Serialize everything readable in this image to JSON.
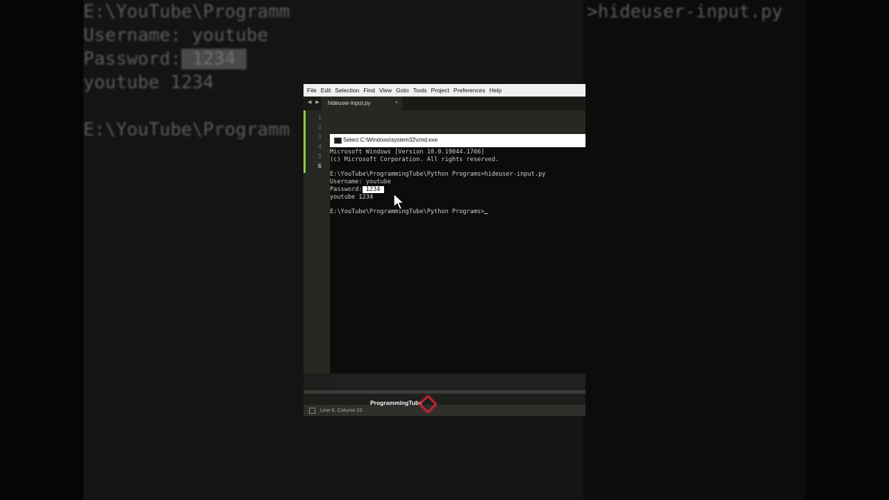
{
  "background": {
    "line1": "E:\\YouTube\\Programm",
    "line1_right": ">hideuser-input.py",
    "username_line": "Username: youtube",
    "password_label": "Password:",
    "password_value": " 1234 ",
    "output_line": "youtube 1234",
    "prompt_line": "E:\\YouTube\\Programm"
  },
  "editor": {
    "menu": [
      "File",
      "Edit",
      "Selection",
      "Find",
      "View",
      "Goto",
      "Tools",
      "Project",
      "Preferences",
      "Help"
    ],
    "nav_arrows": "◀ ▶",
    "tab_label": "hideuser-input.py",
    "tab_close": "×",
    "line_numbers": [
      "1",
      "2",
      "3",
      "4",
      "5",
      "6"
    ],
    "current_line": "6",
    "status_text": "Line 6, Column 22",
    "watermark": "ProgrammingTube",
    "colors": {
      "accent_change": "#8ad14a",
      "logo": "#e0203a"
    }
  },
  "cmd": {
    "title": "Select C:\\Windows\\system32\\cmd.exe",
    "version_line": "Microsoft Windows [Version 10.0.19044.1766]",
    "copyright_line": "(c) Microsoft Corporation. All rights reserved.",
    "command_line": "E:\\YouTube\\ProgrammingTube\\Python Programs>hideuser-input.py",
    "username_line": "Username: youtube",
    "password_label": "Password:",
    "password_selected": " 1234 ",
    "output_line": "youtube 1234",
    "prompt_line": "E:\\YouTube\\ProgrammingTube\\Python Programs>"
  }
}
